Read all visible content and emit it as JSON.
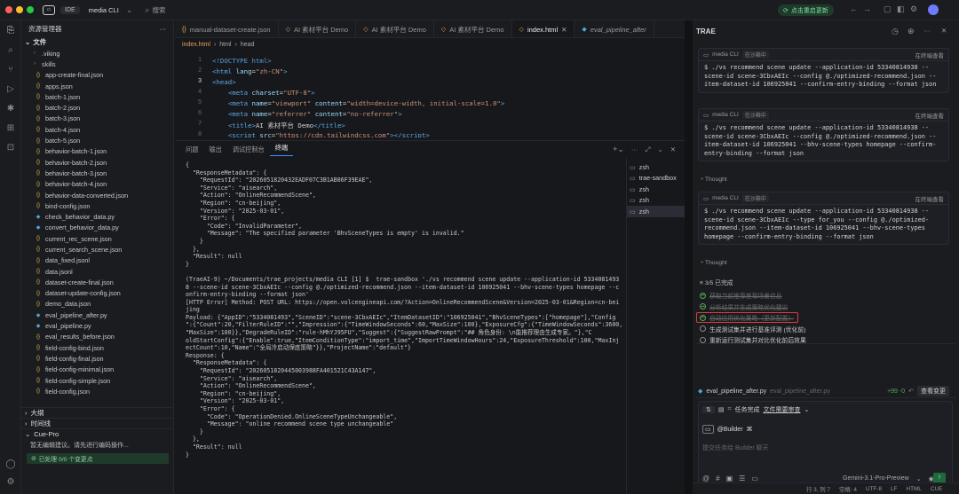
{
  "titlebar": {
    "ide": "IDE",
    "project": "media CLI",
    "search": "搜索",
    "update": "点击重启更新"
  },
  "explorer": {
    "title": "资源管理器",
    "section": "文件",
    "items": [
      {
        "name": ".viking",
        "type": "folder"
      },
      {
        "name": "skills",
        "type": "folder"
      },
      {
        "name": "app-create-final.json",
        "type": "json"
      },
      {
        "name": "apps.json",
        "type": "json"
      },
      {
        "name": "batch-1.json",
        "type": "json"
      },
      {
        "name": "batch-2.json",
        "type": "json"
      },
      {
        "name": "batch-3.json",
        "type": "json"
      },
      {
        "name": "batch-4.json",
        "type": "json"
      },
      {
        "name": "batch-5.json",
        "type": "json"
      },
      {
        "name": "behavior-batch-1.json",
        "type": "json"
      },
      {
        "name": "behavior-batch-2.json",
        "type": "json"
      },
      {
        "name": "behavior-batch-3.json",
        "type": "json"
      },
      {
        "name": "behavior-batch-4.json",
        "type": "json"
      },
      {
        "name": "behavior-data-converted.json",
        "type": "json"
      },
      {
        "name": "bind-config.json",
        "type": "json"
      },
      {
        "name": "check_behavior_data.py",
        "type": "py"
      },
      {
        "name": "convert_behavior_data.py",
        "type": "py"
      },
      {
        "name": "current_rec_scene.json",
        "type": "json"
      },
      {
        "name": "current_search_scene.json",
        "type": "json"
      },
      {
        "name": "data_fixed.jsonl",
        "type": "json"
      },
      {
        "name": "data.jsonl",
        "type": "json"
      },
      {
        "name": "dataset-create-final.json",
        "type": "json"
      },
      {
        "name": "dataset-update-config.json",
        "type": "json"
      },
      {
        "name": "demo_data.json",
        "type": "json"
      },
      {
        "name": "eval_pipeline_after.py",
        "type": "py"
      },
      {
        "name": "eval_pipeline.py",
        "type": "py"
      },
      {
        "name": "eval_results_before.json",
        "type": "json"
      },
      {
        "name": "field-config-bind.json",
        "type": "json"
      },
      {
        "name": "field-config-final.json",
        "type": "json"
      },
      {
        "name": "field-config-minimal.json",
        "type": "json"
      },
      {
        "name": "field-config-simple.json",
        "type": "json"
      },
      {
        "name": "field-config.json",
        "type": "json"
      }
    ],
    "outline": "大纲",
    "timeline": "时间线",
    "cuepro": "Cue-Pro",
    "cuepro_msg": "暂无编辑建议。请先进行编码操作...",
    "cuepro_status": "已处理 0/0 个变更点"
  },
  "tabs": [
    {
      "label": "manual-dataset-create.json",
      "active": false
    },
    {
      "label": "AI 素材平台 Demo",
      "active": false
    },
    {
      "label": "AI 素材平台 Demo",
      "active": false
    },
    {
      "label": "AI 素材平台 Demo",
      "active": false
    },
    {
      "label": "index.html",
      "active": true
    },
    {
      "label": "eval_pipeline_after",
      "active": false
    }
  ],
  "breadcrumb": [
    "index.html",
    "html",
    "head"
  ],
  "editor": {
    "lines": [
      "1",
      "2",
      "3",
      "4",
      "5",
      "6",
      "7",
      "8"
    ]
  },
  "panel": {
    "tabs": [
      "问题",
      "输出",
      "调试控制台",
      "终端"
    ],
    "terminal_text": "{\n  \"ResponseMetadata\": {\n    \"RequestId\": \"2026051820432EADF07C3B1AB86F39EAE\",\n    \"Service\": \"aisearch\",\n    \"Action\": \"OnlineRecommendScene\",\n    \"Region\": \"cn-beijing\",\n    \"Version\": \"2025-03-01\",\n    \"Error\": {\n      \"Code\": \"InvalidParameter\",\n      \"Message\": \"The specified parameter 'BhvSceneTypes is empty' is invalid.\"\n    }\n  },\n  \"Result\": null\n}\n\n(TraeAI-9) ~/Documents/trae_projects/media CLI [1] $  trae-sandbox './vs recommend scene update --application-id 5334081493\n8 --scene-id scene-3CbxAEIc --config @./optimized-recommend.json --item-dataset-id 106925041 --bhv-scene-types homepage --c\nonfirm-entry-binding --format json'\n[HTTP Error] Method: POST URL: https://open.volcengineapi.com/?Action=OnlineRecommendScene&Version=2025-03-01&Region=cn-bei\njing\nPayload: {\"AppID\":\"5334081493\",\"SceneID\":\"scene-3CbxAEIc\",\"ItemDatasetID\":\"106925041\",\"BhvSceneTypes\":[\"homepage\"],\"Config\n\":{\"Count\":20,\"FilterRuleID\":\"\",\"Impression\":{\"TimeWindowSeconds\":60,\"MaxSize\":100},\"ExposureCfg\":{\"TimeWindowSeconds\":3600,\n\"MaxSize\":100}},\"DegradeRuleID\":\"rule-hMhYJ95FU\",\"Suggest\":{\"SuggestRawPrompt\":\"## 角色身份: \\n能推荐理由生成专家。\"},\"C\noldStartConfig\":{\"Enable\":true,\"ItemConditionType\":\"import_time\",\"ImportTimeWindowHours\":24,\"ExposureThreshold\":100,\"MaxInj\nectCount\":10,\"Name\":\"全局冷启动保底策略\"}},\"ProjectName\":\"default\"}\nResponse: {\n  \"ResponseMetadata\": {\n    \"RequestId\": \"2026051820445003988FA401521C43A147\",\n    \"Service\": \"aisearch\",\n    \"Action\": \"OnlineRecommendScene\",\n    \"Region\": \"cn-beijing\",\n    \"Version\": \"2025-03-01\",\n    \"Error\": {\n      \"Code\": \"OperationDenied.OnlineSceneTypeUnchangeable\",\n      \"Message\": \"online recommend scene type unchangeable\"\n    }\n  },\n  \"Result\": null\n}",
    "terminals": [
      "zsh",
      "trae-sandbox",
      "zsh",
      "zsh",
      "zsh"
    ]
  },
  "trae": {
    "title": "TRAE",
    "card_project": "media CLI",
    "card_status": "在沙箱中",
    "view_terminal": "在终端查看",
    "cmd1": "$ ./vs recommend scene update --application-id 53340814938 --scene-id scene-3CbxAEIc --config @./optimized-recommend.json --item-dataset-id 106925041 --confirm-entry-binding --format json",
    "cmd2": "$ ./vs recommend scene update --application-id 53340814938 --scene-id scene-3CbxAEIc --config @./optimized-recommend.json --item-dataset-id 106925041 --bhv-scene-types homepage --confirm-entry-binding --format json",
    "thought": "Thought",
    "cmd3": "$ ./vs recommend scene update --application-id 53340814938 --scene-id scene-3CbxAEIc --type for_you --config @./optimized-recommend.json --item-dataset-id 106925041 --bhv-scene-types homepage --confirm-entry-binding --format json",
    "progress": "3/5 已完成",
    "todos": [
      {
        "text": "获取当前推荐推荐场景信息",
        "done": true
      },
      {
        "text": "分析结果并生成策略优化建议",
        "done": true
      },
      {
        "text": "自动应用优化策略（更新配置）",
        "done": true
      },
      {
        "text": "生成测试集并进行基准评测 (优化前)",
        "done": false
      },
      {
        "text": "重新运行测试集并对比优化前后效果",
        "done": false
      }
    ],
    "file": "eval_pipeline_after.py",
    "file_path": "eval_pipeline_after.py",
    "diff": "+99 -0",
    "review": "查看变更",
    "task_done": "任务完成",
    "doc_review": "文件需要审查",
    "builder": "@Builder",
    "placeholder": "提交任务给 Builder 聊天",
    "model": "Gemini-3.1-Pro-Preview"
  },
  "status": {
    "pos": "行 3, 列 7",
    "spaces": "空格: 4",
    "enc": "UTF-8",
    "eol": "LF",
    "lang": "HTML",
    "cue": "CUE"
  }
}
